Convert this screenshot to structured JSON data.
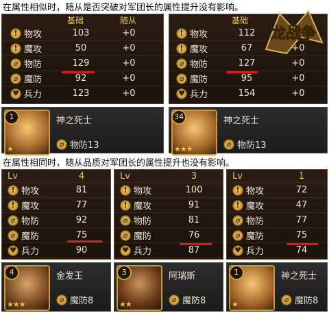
{
  "captions": {
    "top": "在属性相似时，随从是否突破对军团长的属性提升没有影响。",
    "bottom": "在属性相同时，随从品质对军团长的属性提升也没有影响。"
  },
  "logo_text": "龙战争",
  "top_panels": [
    {
      "headers": {
        "base": "基础",
        "bonus": "随从"
      },
      "rows": [
        {
          "icon": "!",
          "label": "物攻",
          "base": "103",
          "bonus": "+0"
        },
        {
          "icon": "!",
          "label": "魔攻",
          "base": "50",
          "bonus": "+0"
        },
        {
          "icon": "⌀",
          "label": "物防",
          "base": "129",
          "bonus": "+0"
        },
        {
          "icon": "⌀",
          "label": "魔防",
          "base": "92",
          "bonus": "+0"
        },
        {
          "icon": "♥",
          "label": "兵力",
          "base": "123",
          "bonus": "+0"
        }
      ],
      "card": {
        "level": "1",
        "name": "神之死士",
        "stat": "物防13"
      }
    },
    {
      "headers": {
        "base": "基础",
        "bonus": ""
      },
      "rows": [
        {
          "icon": "!",
          "label": "物攻",
          "base": "112",
          "bonus": "+0"
        },
        {
          "icon": "!",
          "label": "魔攻",
          "base": "67",
          "bonus": "+0"
        },
        {
          "icon": "⌀",
          "label": "物防",
          "base": "127",
          "bonus": "+0"
        },
        {
          "icon": "⌀",
          "label": "魔防",
          "base": "95",
          "bonus": "+0"
        },
        {
          "icon": "♥",
          "label": "兵力",
          "base": "154",
          "bonus": "+0"
        }
      ],
      "card": {
        "level": "34",
        "name": "神之死士",
        "stat": "物防13"
      }
    }
  ],
  "bottom_panels": [
    {
      "lv_label": "Lv",
      "lv": "4",
      "rows": [
        {
          "icon": "!",
          "label": "物攻",
          "base": "81"
        },
        {
          "icon": "!",
          "label": "魔攻",
          "base": "77"
        },
        {
          "icon": "⌀",
          "label": "物防",
          "base": "92"
        },
        {
          "icon": "⌀",
          "label": "魔防",
          "base": "75"
        },
        {
          "icon": "♥",
          "label": "兵力",
          "base": "90"
        }
      ],
      "card": {
        "level": "4",
        "name": "金发王",
        "stat": "魔防8"
      }
    },
    {
      "lv_label": "Lv",
      "lv": "3",
      "rows": [
        {
          "icon": "!",
          "label": "物攻",
          "base": "100"
        },
        {
          "icon": "!",
          "label": "魔攻",
          "base": "91"
        },
        {
          "icon": "⌀",
          "label": "物防",
          "base": "81"
        },
        {
          "icon": "⌀",
          "label": "魔防",
          "base": "76"
        },
        {
          "icon": "♥",
          "label": "兵力",
          "base": "87"
        }
      ],
      "card": {
        "level": "3",
        "name": "阿瑞斯",
        "stat": "魔防8"
      }
    },
    {
      "lv_label": "Lv",
      "lv": "1",
      "rows": [
        {
          "icon": "!",
          "label": "物攻",
          "base": "72"
        },
        {
          "icon": "!",
          "label": "魔攻",
          "base": "47"
        },
        {
          "icon": "⌀",
          "label": "物防",
          "base": "77"
        },
        {
          "icon": "⌀",
          "label": "魔防",
          "base": "75"
        },
        {
          "icon": "♥",
          "label": "兵力",
          "base": "74"
        }
      ],
      "card": {
        "level": "1",
        "name": "神之死士",
        "stat": "魔防8"
      }
    }
  ],
  "colors": {
    "highlight": "#e01818",
    "gold": "#e8c35a"
  }
}
